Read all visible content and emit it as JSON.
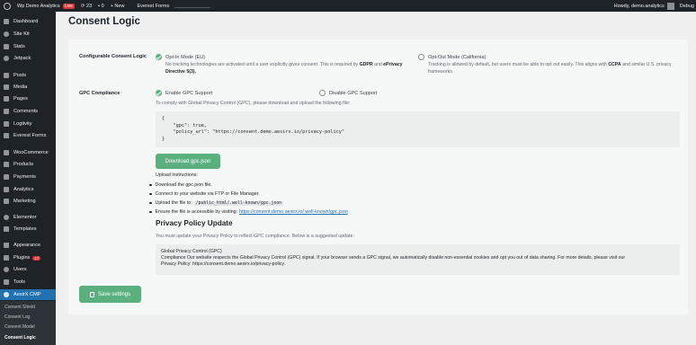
{
  "adminbar": {
    "site_name": "Wp Demo Analytics",
    "live_badge": "Live",
    "updates_count": "23",
    "comments_count": "0",
    "new_label": "+ New",
    "plugin_link": "Everest Forms",
    "howdy": "Howdy, demo.analytics",
    "debug": "Debug"
  },
  "sidebar": {
    "items": [
      {
        "label": "Dashboard",
        "icon": "dashboard-icon"
      },
      {
        "label": "Site Kit",
        "icon": "site-kit-icon"
      },
      {
        "label": "Stats",
        "icon": "stats-icon"
      },
      {
        "label": "Jetpack",
        "icon": "jetpack-icon"
      },
      {
        "label": "Posts",
        "icon": "posts-icon"
      },
      {
        "label": "Media",
        "icon": "media-icon"
      },
      {
        "label": "Pages",
        "icon": "pages-icon"
      },
      {
        "label": "Comments",
        "icon": "comments-icon"
      },
      {
        "label": "Logtivity",
        "icon": "logtivity-icon"
      },
      {
        "label": "Everest Forms",
        "icon": "everest-forms-icon"
      },
      {
        "label": "WooCommerce",
        "icon": "woocommerce-icon"
      },
      {
        "label": "Products",
        "icon": "products-icon"
      },
      {
        "label": "Payments",
        "icon": "payments-icon"
      },
      {
        "label": "Analytics",
        "icon": "analytics-icon"
      },
      {
        "label": "Marketing",
        "icon": "marketing-icon"
      },
      {
        "label": "Elementor",
        "icon": "elementor-icon"
      },
      {
        "label": "Templates",
        "icon": "templates-icon"
      },
      {
        "label": "Appearance",
        "icon": "appearance-icon"
      },
      {
        "label": "Plugins",
        "icon": "plugins-icon",
        "badge": "17"
      },
      {
        "label": "Users",
        "icon": "users-icon"
      },
      {
        "label": "Tools",
        "icon": "tools-icon"
      },
      {
        "label": "AesirX CMP",
        "icon": "aesirx-icon"
      }
    ],
    "subitems": [
      "Consent Shield",
      "Consent Log",
      "Consent Model",
      "Consent Logic"
    ]
  },
  "page": {
    "title": "Consent Logic"
  },
  "consent_logic": {
    "label": "Configurable Consent Logic",
    "opt_in": {
      "title": "Opt-In Mode (EU)",
      "desc_1": "No tracking technologies are activated until a user explicitly gives consent. This is required by",
      "desc_gdpr": "GDPR",
      "desc_and": "and",
      "desc_eprivacy": "ePrivacy Directive 5(3).",
      "checked": true
    },
    "opt_out": {
      "title": "Opt-Out Mode (California)",
      "desc_1": "Tracking is allowed by default, but users must be able to opt out easily. This aligns with",
      "desc_ccpa": "CCPA",
      "desc_2": "and similar",
      "desc_3": "U.S. privacy frameworks.",
      "checked": false
    }
  },
  "gpc": {
    "label": "GPC Compliance",
    "enable_label": "Enable GPC Support",
    "disable_label": "Disable GPC Support",
    "instructions_intro": "To comply with Global Privacy Control (GPC), please download and upload the following file:",
    "code_lines": [
      "{",
      "    \"gpc\": true,",
      "    \"policy_url\": \"https://consent.demo.aesirx.io/privacy-policy\"",
      "}"
    ],
    "download_button": "Download gpc.json",
    "upload_title": "Upload Instructions:",
    "steps": [
      {
        "text": "Download the gpc.json file."
      },
      {
        "text": "Connect to your website via FTP or File Manager."
      },
      {
        "text": "Upload the file to:",
        "code": "/public_html/.well-known/gpc.json"
      },
      {
        "text": "Ensure the file is accessible by visiting:",
        "link": "https://consent.demo.aesirx.io/.well-known/gpc.json"
      }
    ]
  },
  "privacy_policy": {
    "title": "Privacy Policy Update",
    "intro": "You must update your Privacy Policy to reflect GPC compliance. Below is a suggested update:",
    "box_title": "Global Privacy Control (GPC)",
    "box_line_1": "Compliance Our website respects the Global Privacy Control (GPC) signal. If your browser sends a GPC signal, we automatically disable non-essential cookies and opt you out of data sharing. For more details, please visit our",
    "box_line_2": "Privacy Policy: https://consent.demo.aesirx.io/privacy-policy."
  },
  "footer": {
    "save_button": "Save settings"
  },
  "colors": {
    "accent_green": "#5bb07f",
    "admin_dark": "#1d2327",
    "active_blue": "#2271b1"
  }
}
